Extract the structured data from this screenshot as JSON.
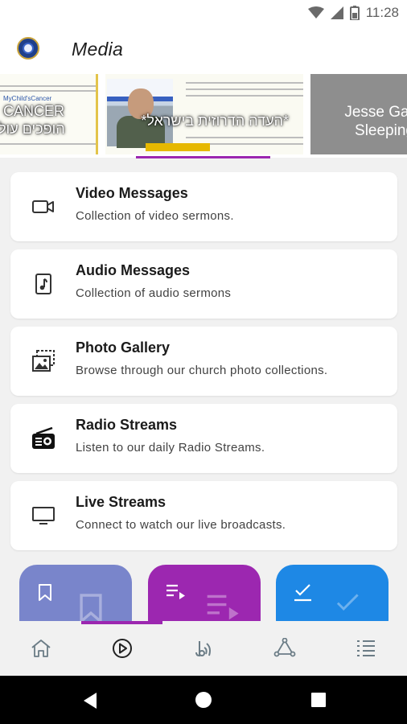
{
  "status_bar": {
    "time": "11:28"
  },
  "app_bar": {
    "title": "Media"
  },
  "carousel": {
    "slides": [
      {
        "line1": "CANCER",
        "line2": "הופכים עול",
        "tag": "MyChild'sCancer"
      },
      {
        "caption": "*העדה הדרוזית בישראל*"
      },
      {
        "caption": "Jesse Galla Sleeping"
      }
    ]
  },
  "menu": [
    {
      "icon": "video-camera-icon",
      "title": "Video Messages",
      "subtitle": "Collection of video sermons."
    },
    {
      "icon": "audio-file-icon",
      "title": "Audio Messages",
      "subtitle": "Collection of audio sermons"
    },
    {
      "icon": "photo-gallery-icon",
      "title": "Photo Gallery",
      "subtitle": "Browse through our church photo collections."
    },
    {
      "icon": "radio-icon",
      "title": "Radio Streams",
      "subtitle": "Listen to our daily Radio Streams."
    },
    {
      "icon": "tv-icon",
      "title": "Live Streams",
      "subtitle": "Connect to watch our live broadcasts."
    }
  ],
  "tiles": [
    {
      "icon": "bookmark-icon",
      "color": "#7985cb"
    },
    {
      "icon": "playlist-icon",
      "color": "#9c27b0"
    },
    {
      "icon": "checklist-icon",
      "color": "#1e88e5"
    }
  ],
  "bottom_nav": [
    {
      "icon": "home-icon",
      "active": false
    },
    {
      "icon": "play-circle-icon",
      "active": true
    },
    {
      "icon": "bible-icon",
      "active": false
    },
    {
      "icon": "community-icon",
      "active": false
    },
    {
      "icon": "list-menu-icon",
      "active": false
    }
  ],
  "colors": {
    "accent": "#9c27b0",
    "tile_blue": "#1e88e5",
    "tile_lavender": "#7985cb"
  }
}
